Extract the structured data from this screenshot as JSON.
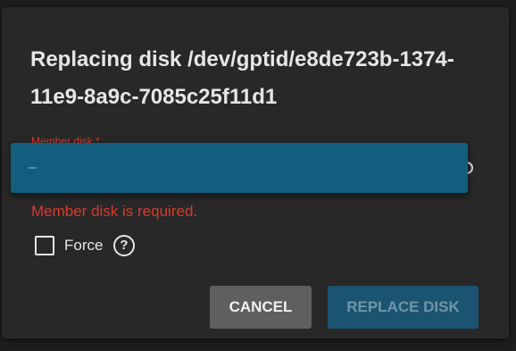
{
  "dialog": {
    "title": "Replacing disk /dev/gptid/e8de723b-1374-11e9-8a9c-7085c25f11d1",
    "member_disk": {
      "label": "Member disk *",
      "dropdown_option": "–",
      "error": "Member disk is required."
    },
    "force": {
      "label": "Force",
      "checked": false,
      "help_icon": "?"
    },
    "buttons": {
      "cancel": "CANCEL",
      "replace": "REPLACE DISK"
    }
  },
  "colors": {
    "dialog_bg": "#282828",
    "error": "#d83a2f",
    "dropdown_bg": "#135e7f",
    "primary_disabled": "#1b5470",
    "cancel_bg": "#5f5f5f"
  }
}
